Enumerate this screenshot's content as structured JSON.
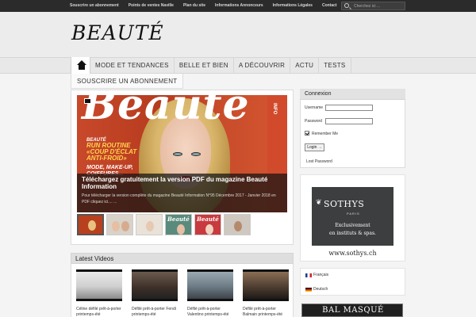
{
  "topbar": {
    "links": [
      "Souscrire un abonnement",
      "Points de ventes Naville",
      "Plan du site",
      "Informations Annonceurs",
      "Informations Légales",
      "Contact"
    ],
    "search_placeholder": "Cherchez ici ..."
  },
  "header": {
    "logo": "BEAUTÉ"
  },
  "nav": {
    "items": [
      "MODE ET TENDANCES",
      "BELLE ET BIEN",
      "A DÉCOUVRIR",
      "ACTU",
      "TESTS"
    ],
    "second_row": "SOUSCRIRE UN ABONNEMENT"
  },
  "slider": {
    "magazine_title": "Beauté",
    "cover_texts": [
      "BEAUTÉ",
      "RUN ROUTINE «COUP D'ÉCLAT ANTI-FROID»",
      "MODE, MAKE-UP, COIFFURES..."
    ],
    "side_text": "INFO",
    "caption_title": "Téléchargez gratuitement la version PDF du magazine Beauté Information",
    "caption_text": "Pour télécharger la version complète du magazine Beauté Information N°95 Décembre 2017 - Janvier 2018 en PDF cliquez ici.... ..."
  },
  "login": {
    "title": "Connexion",
    "username_label": "Username",
    "password_label": "Password",
    "remember_label": "Remember Me",
    "remember_checked": true,
    "button_label": "Login →",
    "lost_password": "Lost Password"
  },
  "ad_sothys": {
    "brand": "SOTHYS",
    "paris": "PARIS",
    "line1": "Exclusivement",
    "line2": "en instituts & spas.",
    "url": "www.sothys.ch"
  },
  "languages": [
    {
      "label": "Français",
      "flag": "fr"
    },
    {
      "label": "Deutsch",
      "flag": "de"
    }
  ],
  "ad_bal": {
    "text": "BAL MASQUÉ"
  },
  "videos": {
    "title": "Latest Videos",
    "items": [
      {
        "caption": "Céline défilé prêt-à-porter printemps-été"
      },
      {
        "caption": "Défilé prêt-à-porter Fendi printemps-été"
      },
      {
        "caption": "Défilé prêt-à-porter Valentino printemps-été"
      },
      {
        "caption": "Défilé prêt-à-porter Balmain printemps-été"
      }
    ]
  },
  "colors": {
    "topbar_bg": "#2b2b2b",
    "header_bg": "#ececec",
    "caption_overlay": "#141414",
    "cover_red": "#c8482a",
    "sothys_bg": "#3c3e3f"
  }
}
